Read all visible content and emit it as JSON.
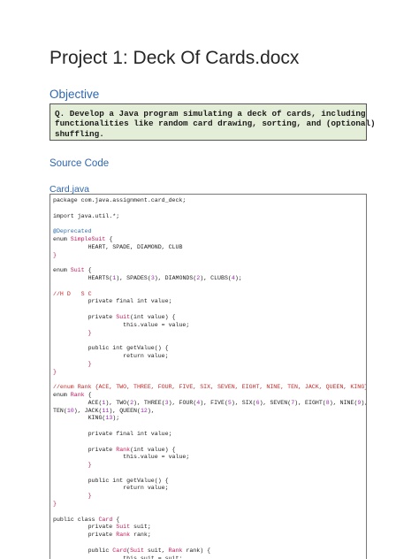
{
  "document": {
    "title": "Project 1: Deck Of Cards.docx",
    "objective_heading": "Objective",
    "objective_lines": [
      "Q. Develop a Java program simulating a deck of cards, including",
      "functionalities like random card drawing, sorting, and (optional)",
      "shuffling."
    ],
    "source_heading": "Source Code",
    "file_heading": "Card.java"
  },
  "code_lines": [
    [
      [
        "package com.java.assignment.card_deck;",
        "kw"
      ]
    ],
    [
      [
        "",
        "kw"
      ]
    ],
    [
      [
        "import java.util.*;",
        "kw"
      ]
    ],
    [
      [
        "",
        "kw"
      ]
    ],
    [
      [
        "@Deprecated",
        "ann"
      ]
    ],
    [
      [
        "enum ",
        "kw"
      ],
      [
        "SimpleSuit",
        "id"
      ],
      [
        " {",
        "kw"
      ]
    ],
    [
      [
        "          HEART, SPADE, DIAMOND, CLUB",
        "kw"
      ]
    ],
    [
      [
        "}",
        "id"
      ]
    ],
    [
      [
        "",
        "kw"
      ]
    ],
    [
      [
        "enum ",
        "kw"
      ],
      [
        "Suit",
        "id"
      ],
      [
        " {",
        "kw"
      ]
    ],
    [
      [
        "          HEARTS(",
        "kw"
      ],
      [
        "1",
        "num"
      ],
      [
        "), SPADES(",
        "kw"
      ],
      [
        "3",
        "num"
      ],
      [
        "), DIAMONDS(",
        "kw"
      ],
      [
        "2",
        "num"
      ],
      [
        "), CLUBS(",
        "kw"
      ],
      [
        "4",
        "num"
      ],
      [
        ");",
        "kw"
      ]
    ],
    [
      [
        "",
        "kw"
      ]
    ],
    [
      [
        "//H D   S C",
        "cm"
      ]
    ],
    [
      [
        "          private final int value;",
        "kw"
      ]
    ],
    [
      [
        "",
        "kw"
      ]
    ],
    [
      [
        "          private ",
        "kw"
      ],
      [
        "Suit",
        "id"
      ],
      [
        "(int value) {",
        "kw"
      ]
    ],
    [
      [
        "                    this.value = value;",
        "kw"
      ]
    ],
    [
      [
        "          }",
        "id"
      ]
    ],
    [
      [
        "",
        "kw"
      ]
    ],
    [
      [
        "          public int getValue() {",
        "kw"
      ]
    ],
    [
      [
        "                    return value;",
        "kw"
      ]
    ],
    [
      [
        "          }",
        "id"
      ]
    ],
    [
      [
        "}",
        "id"
      ]
    ],
    [
      [
        "",
        "kw"
      ]
    ],
    [
      [
        "//enum Rank {ACE, TWO, THREE, FOUR, FIVE, SIX, SEVEN, EIGHT, NINE, TEN, JACK, QUEEN, KING}",
        "cm"
      ]
    ],
    [
      [
        "enum ",
        "kw"
      ],
      [
        "Rank",
        "id"
      ],
      [
        " {",
        "kw"
      ]
    ],
    [
      [
        "          ACE(",
        "kw"
      ],
      [
        "1",
        "num"
      ],
      [
        "), TWO(",
        "kw"
      ],
      [
        "2",
        "num"
      ],
      [
        "), THREE(",
        "kw"
      ],
      [
        "3",
        "num"
      ],
      [
        "), FOUR(",
        "kw"
      ],
      [
        "4",
        "num"
      ],
      [
        "), FIVE(",
        "kw"
      ],
      [
        "5",
        "num"
      ],
      [
        "), SIX(",
        "kw"
      ],
      [
        "6",
        "num"
      ],
      [
        "), SEVEN(",
        "kw"
      ],
      [
        "7",
        "num"
      ],
      [
        "), EIGHT(",
        "kw"
      ],
      [
        "8",
        "num"
      ],
      [
        "), NINE(",
        "kw"
      ],
      [
        "9",
        "num"
      ],
      [
        "),",
        "kw"
      ]
    ],
    [
      [
        "TEN(",
        "kw"
      ],
      [
        "10",
        "num"
      ],
      [
        "), JACK(",
        "kw"
      ],
      [
        "11",
        "num"
      ],
      [
        "), QUEEN(",
        "kw"
      ],
      [
        "12",
        "num"
      ],
      [
        "),",
        "kw"
      ]
    ],
    [
      [
        "          KING(",
        "kw"
      ],
      [
        "13",
        "num"
      ],
      [
        ");",
        "kw"
      ]
    ],
    [
      [
        "",
        "kw"
      ]
    ],
    [
      [
        "          private final int value;",
        "kw"
      ]
    ],
    [
      [
        "",
        "kw"
      ]
    ],
    [
      [
        "          private ",
        "kw"
      ],
      [
        "Rank",
        "id"
      ],
      [
        "(int value) {",
        "kw"
      ]
    ],
    [
      [
        "                    this.value = value;",
        "kw"
      ]
    ],
    [
      [
        "          }",
        "id"
      ]
    ],
    [
      [
        "",
        "kw"
      ]
    ],
    [
      [
        "          public int getValue() {",
        "kw"
      ]
    ],
    [
      [
        "                    return value;",
        "kw"
      ]
    ],
    [
      [
        "          }",
        "id"
      ]
    ],
    [
      [
        "}",
        "id"
      ]
    ],
    [
      [
        "",
        "kw"
      ]
    ],
    [
      [
        "public class ",
        "kw"
      ],
      [
        "Card",
        "id"
      ],
      [
        " {",
        "kw"
      ]
    ],
    [
      [
        "          private ",
        "kw"
      ],
      [
        "Suit",
        "id"
      ],
      [
        " suit;",
        "kw"
      ]
    ],
    [
      [
        "          private ",
        "kw"
      ],
      [
        "Rank",
        "id"
      ],
      [
        " rank;",
        "kw"
      ]
    ],
    [
      [
        "",
        "kw"
      ]
    ],
    [
      [
        "          public ",
        "kw"
      ],
      [
        "Card",
        "id"
      ],
      [
        "(",
        "kw"
      ],
      [
        "Suit",
        "id"
      ],
      [
        " suit, ",
        "kw"
      ],
      [
        "Rank",
        "id"
      ],
      [
        " rank) {",
        "kw"
      ]
    ],
    [
      [
        "                    this.suit = suit;",
        "kw"
      ]
    ]
  ]
}
